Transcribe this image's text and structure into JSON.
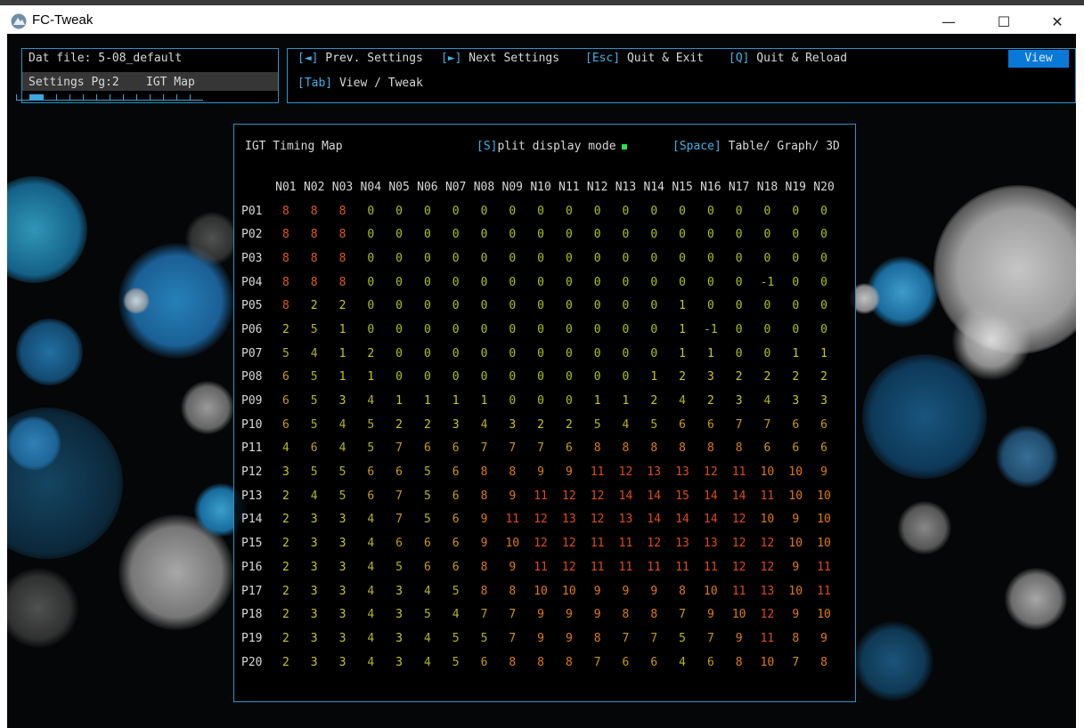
{
  "window": {
    "title": "FC-Tweak",
    "minimize": "—",
    "maximize": "☐",
    "close": "✕"
  },
  "header": {
    "dat_file": "Dat file: 5-08_default",
    "settings_page": "Settings Pg:2",
    "settings_name": "IGT Map",
    "page_count": 14,
    "active_page": 2,
    "shortcuts": [
      {
        "key": "[◄]",
        "label": " Prev. Settings"
      },
      {
        "key": "[►]",
        "label": " Next Settings"
      },
      {
        "key": "[Esc]",
        "label": " Quit & Exit"
      },
      {
        "key": "[Q]",
        "label": " Quit & Reload"
      },
      {
        "key": "[Tab]",
        "label": " View / Tweak"
      }
    ],
    "mode_badge": "View"
  },
  "panel": {
    "title": "IGT Timing Map",
    "split_key": "[S]",
    "split_label": "plit display mode",
    "space_key": "[Space]",
    "space_label": " Table/ Graph/ 3D"
  },
  "table": {
    "columns": [
      "N01",
      "N02",
      "N03",
      "N04",
      "N05",
      "N06",
      "N07",
      "N08",
      "N09",
      "N10",
      "N11",
      "N12",
      "N13",
      "N14",
      "N15",
      "N16",
      "N17",
      "N18",
      "N19",
      "N20"
    ],
    "rows": [
      {
        "label": "P01",
        "values": [
          8,
          8,
          8,
          0,
          0,
          0,
          0,
          0,
          0,
          0,
          0,
          0,
          0,
          0,
          0,
          0,
          0,
          0,
          0,
          0
        ]
      },
      {
        "label": "P02",
        "values": [
          8,
          8,
          8,
          0,
          0,
          0,
          0,
          0,
          0,
          0,
          0,
          0,
          0,
          0,
          0,
          0,
          0,
          0,
          0,
          0
        ]
      },
      {
        "label": "P03",
        "values": [
          8,
          8,
          8,
          0,
          0,
          0,
          0,
          0,
          0,
          0,
          0,
          0,
          0,
          0,
          0,
          0,
          0,
          0,
          0,
          0
        ]
      },
      {
        "label": "P04",
        "values": [
          8,
          8,
          8,
          0,
          0,
          0,
          0,
          0,
          0,
          0,
          0,
          0,
          0,
          0,
          0,
          0,
          0,
          -1,
          0,
          0
        ]
      },
      {
        "label": "P05",
        "values": [
          8,
          2,
          2,
          0,
          0,
          0,
          0,
          0,
          0,
          0,
          0,
          0,
          0,
          0,
          1,
          0,
          0,
          0,
          0,
          0
        ]
      },
      {
        "label": "P06",
        "values": [
          2,
          5,
          1,
          0,
          0,
          0,
          0,
          0,
          0,
          0,
          0,
          0,
          0,
          0,
          1,
          -1,
          0,
          0,
          0,
          0
        ]
      },
      {
        "label": "P07",
        "values": [
          5,
          4,
          1,
          2,
          0,
          0,
          0,
          0,
          0,
          0,
          0,
          0,
          0,
          0,
          1,
          1,
          0,
          0,
          1,
          1
        ]
      },
      {
        "label": "P08",
        "values": [
          6,
          5,
          1,
          1,
          0,
          0,
          0,
          0,
          0,
          0,
          0,
          0,
          0,
          1,
          2,
          3,
          2,
          2,
          2,
          2
        ]
      },
      {
        "label": "P09",
        "values": [
          6,
          5,
          3,
          4,
          1,
          1,
          1,
          1,
          0,
          0,
          0,
          1,
          1,
          2,
          4,
          2,
          3,
          4,
          3,
          3
        ]
      },
      {
        "label": "P10",
        "values": [
          6,
          5,
          4,
          5,
          2,
          2,
          3,
          4,
          3,
          2,
          2,
          5,
          4,
          5,
          6,
          6,
          7,
          7,
          6,
          6
        ]
      },
      {
        "label": "P11",
        "values": [
          4,
          6,
          4,
          5,
          7,
          6,
          6,
          7,
          7,
          7,
          6,
          8,
          8,
          8,
          8,
          8,
          8,
          6,
          6,
          6
        ]
      },
      {
        "label": "P12",
        "values": [
          3,
          5,
          5,
          6,
          6,
          5,
          6,
          8,
          8,
          9,
          9,
          11,
          12,
          13,
          13,
          12,
          11,
          10,
          10,
          9
        ]
      },
      {
        "label": "P13",
        "values": [
          2,
          4,
          5,
          6,
          7,
          5,
          6,
          8,
          9,
          11,
          12,
          12,
          14,
          14,
          15,
          14,
          14,
          11,
          10,
          10
        ]
      },
      {
        "label": "P14",
        "values": [
          2,
          3,
          3,
          4,
          7,
          5,
          6,
          9,
          11,
          12,
          13,
          12,
          13,
          14,
          14,
          14,
          12,
          10,
          9,
          10
        ]
      },
      {
        "label": "P15",
        "values": [
          2,
          3,
          3,
          4,
          6,
          6,
          6,
          9,
          10,
          12,
          12,
          11,
          11,
          12,
          13,
          13,
          12,
          12,
          10,
          10
        ]
      },
      {
        "label": "P16",
        "values": [
          2,
          3,
          3,
          4,
          5,
          6,
          6,
          8,
          9,
          11,
          12,
          11,
          11,
          11,
          11,
          11,
          12,
          12,
          9,
          11
        ]
      },
      {
        "label": "P17",
        "values": [
          2,
          3,
          3,
          4,
          3,
          4,
          5,
          8,
          8,
          10,
          10,
          9,
          9,
          9,
          8,
          10,
          11,
          13,
          10,
          11
        ]
      },
      {
        "label": "P18",
        "values": [
          2,
          3,
          3,
          4,
          3,
          5,
          4,
          7,
          7,
          9,
          9,
          9,
          8,
          8,
          7,
          9,
          10,
          12,
          9,
          10
        ]
      },
      {
        "label": "P19",
        "values": [
          2,
          3,
          3,
          4,
          3,
          4,
          5,
          5,
          7,
          9,
          9,
          8,
          7,
          7,
          5,
          7,
          9,
          11,
          8,
          9
        ]
      },
      {
        "label": "P20",
        "values": [
          2,
          3,
          3,
          4,
          3,
          4,
          5,
          6,
          8,
          8,
          8,
          7,
          6,
          6,
          4,
          6,
          8,
          10,
          7,
          8
        ]
      }
    ]
  },
  "colors": {
    "accent": "#3fb3ea",
    "mode_indicator": "#29e14a",
    "badge": "#0a78d7"
  }
}
